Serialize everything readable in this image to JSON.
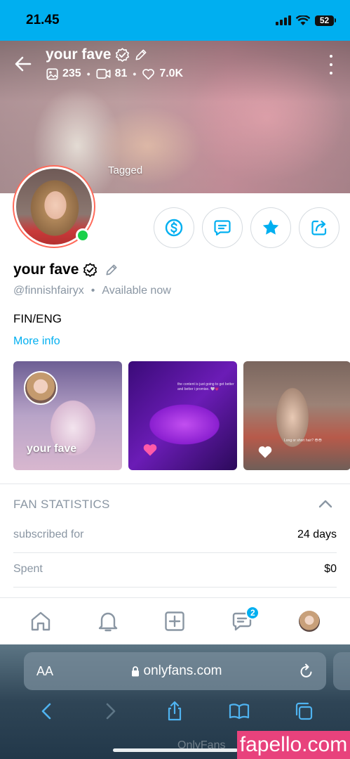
{
  "status_bar": {
    "time": "21.45",
    "battery": "52"
  },
  "cover": {
    "title": "your fave",
    "stats": {
      "photos": "235",
      "videos": "81",
      "likes": "7.0K"
    },
    "tagged_label": "Tagged"
  },
  "profile": {
    "name": "your fave",
    "handle": "@finnishfairyx",
    "availability": "Available now",
    "bio": "FIN/ENG",
    "more_info": "More info"
  },
  "highlights": [
    {
      "label": "your fave"
    },
    {
      "caption": "the content is just going to get better and better i promise. 🤍💗"
    },
    {
      "caption": "Long or short hair? 😳😳"
    }
  ],
  "fan_statistics": {
    "heading": "FAN STATISTICS",
    "rows": [
      {
        "label": "subscribed for",
        "value": "24 days"
      },
      {
        "label": "Spent",
        "value": "$0"
      }
    ]
  },
  "bottom_nav": {
    "messages_badge": "2"
  },
  "browser": {
    "aa_label": "AA",
    "url": "onlyfans.com",
    "faint_watermark": "OnlyFans"
  },
  "watermark": "fapello.com",
  "colors": {
    "accent": "#00aff0",
    "online": "#1bd04a",
    "avatar_ring": "#ff6a5a",
    "watermark_bg": "#e8427c"
  }
}
